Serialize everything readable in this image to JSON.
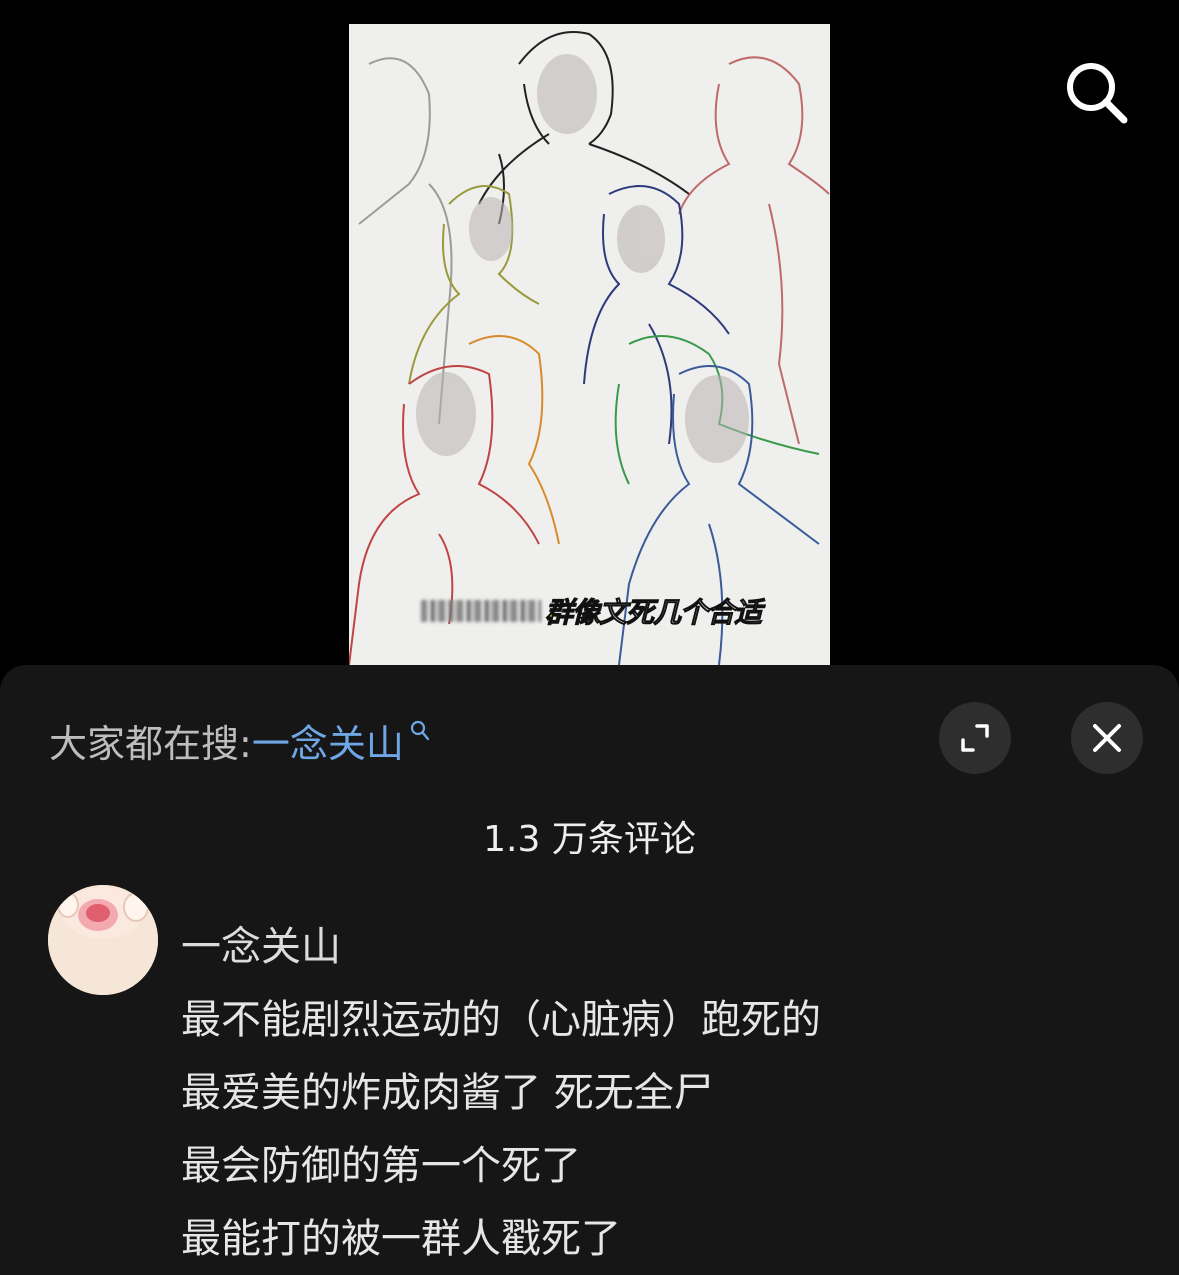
{
  "video": {
    "caption_highlight": "群像",
    "caption_rest": "文死几个合适"
  },
  "header": {
    "search_icon": "search-icon"
  },
  "sheet": {
    "trending_prefix": "大家都在搜:",
    "trending_query": "一念关山",
    "expand_icon": "expand-icon",
    "close_icon": "close-icon",
    "comment_count": "1.3 万条评论"
  },
  "comments": [
    {
      "username": "一念关山",
      "lines": [
        "最不能剧烈运动的（心脏病）跑死的",
        "最爱美的炸成肉酱了 死无全尸",
        "最会防御的第一个死了",
        "最能打的被一群人戳死了"
      ]
    }
  ],
  "colors": {
    "background": "#000000",
    "sheet": "#161616",
    "link": "#6fa7e6",
    "caption_highlight": "#7cff1e"
  }
}
